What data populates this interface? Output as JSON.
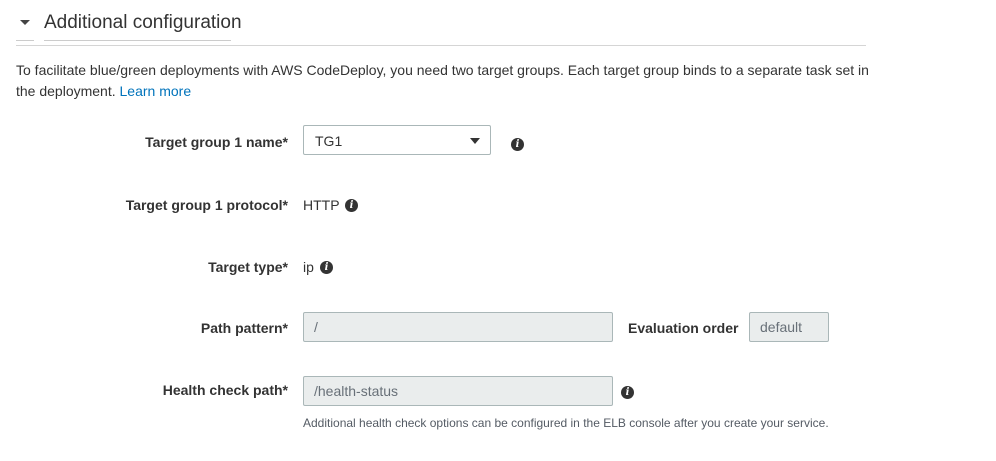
{
  "section": {
    "title": "Additional configuration",
    "description": "To facilitate blue/green deployments with AWS CodeDeploy, you need two target groups. Each target group binds to a separate task set in the deployment.",
    "learn_more": "Learn more"
  },
  "fields": {
    "target_group_1_name": {
      "label": "Target group 1 name*",
      "value": "TG1"
    },
    "target_group_1_protocol": {
      "label": "Target group 1 protocol*",
      "value": "HTTP"
    },
    "target_type": {
      "label": "Target type*",
      "value": "ip"
    },
    "path_pattern": {
      "label": "Path pattern*",
      "value": "/"
    },
    "evaluation_order": {
      "label": "Evaluation order",
      "value": "default"
    },
    "health_check_path": {
      "label": "Health check path*",
      "value": "/health-status",
      "hint": "Additional health check options can be configured in the ELB console after you create your service."
    }
  },
  "icons": {
    "info": "i",
    "expand": "caret-down-icon"
  },
  "colors": {
    "link": "#0073bb",
    "disabled_bg": "#eaeded",
    "border": "#aab7b8"
  }
}
